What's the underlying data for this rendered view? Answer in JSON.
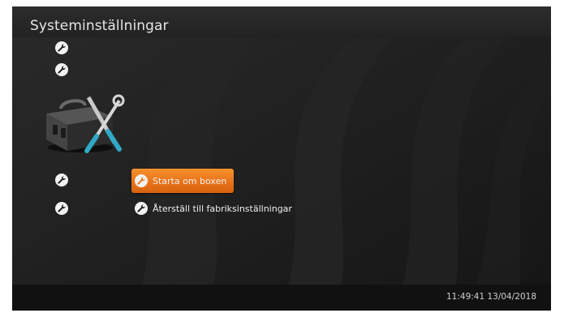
{
  "header": {
    "title": "Systeminställningar"
  },
  "menu": {
    "items": [
      {
        "label": "Starta om boxen",
        "selected": true
      },
      {
        "label": "Återställ till fabriksinställningar",
        "selected": false
      }
    ]
  },
  "footer": {
    "clock": "11:49:41 13/04/2018"
  },
  "colors": {
    "accent": "#EE7A1E",
    "background": "#1B1B1B"
  },
  "icons": [
    "wrench-icon",
    "toolbox-icon"
  ]
}
